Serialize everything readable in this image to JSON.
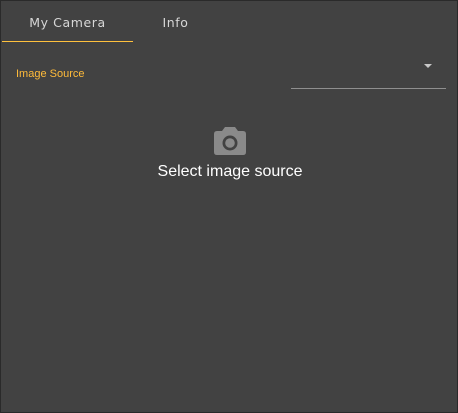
{
  "tabs": [
    {
      "label": "My Camera",
      "active": true
    },
    {
      "label": "Info",
      "active": false
    }
  ],
  "image_source": {
    "label": "Image Source",
    "value": ""
  },
  "placeholder": {
    "icon": "camera-icon",
    "text": "Select image source"
  },
  "colors": {
    "background": "#424242",
    "accent": "#ffc13d",
    "text": "#ffffff",
    "tab_text": "#d7d7d7"
  }
}
